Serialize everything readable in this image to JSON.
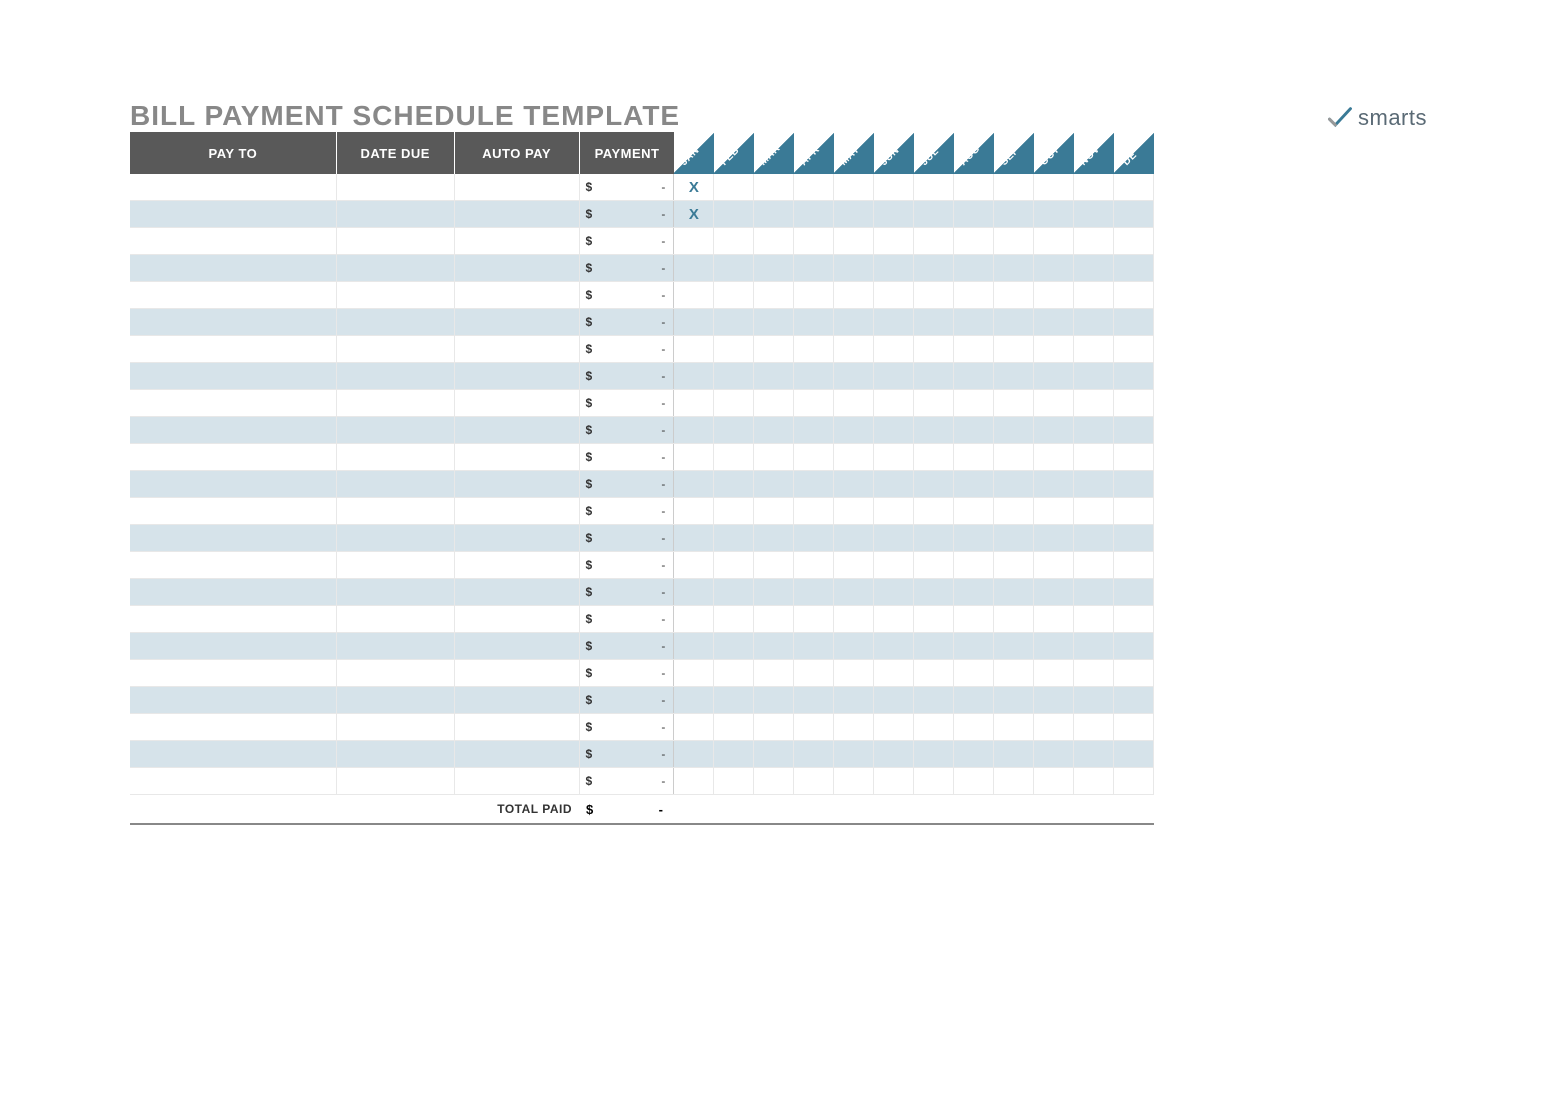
{
  "title": "BILL PAYMENT SCHEDULE TEMPLATE",
  "logo_text": "smarts",
  "headers": {
    "pay_to": "PAY TO",
    "date_due": "DATE DUE",
    "auto_pay": "AUTO PAY",
    "payment": "PAYMENT"
  },
  "months": [
    "JAN",
    "FEB",
    "MAR",
    "APR",
    "MAY",
    "JUN",
    "JUL",
    "AUG",
    "SEP",
    "OCT",
    "NOV",
    "DE"
  ],
  "currency": "$",
  "dash": "-",
  "rows": [
    {
      "pay_to": "",
      "date_due": "",
      "auto_pay": "",
      "payment": "-",
      "marks": [
        "X",
        "",
        "",
        "",
        "",
        "",
        "",
        "",
        "",
        "",
        "",
        ""
      ]
    },
    {
      "pay_to": "",
      "date_due": "",
      "auto_pay": "",
      "payment": "-",
      "marks": [
        "X",
        "",
        "",
        "",
        "",
        "",
        "",
        "",
        "",
        "",
        "",
        ""
      ]
    },
    {
      "pay_to": "",
      "date_due": "",
      "auto_pay": "",
      "payment": "-",
      "marks": [
        "",
        "",
        "",
        "",
        "",
        "",
        "",
        "",
        "",
        "",
        "",
        ""
      ]
    },
    {
      "pay_to": "",
      "date_due": "",
      "auto_pay": "",
      "payment": "-",
      "marks": [
        "",
        "",
        "",
        "",
        "",
        "",
        "",
        "",
        "",
        "",
        "",
        ""
      ]
    },
    {
      "pay_to": "",
      "date_due": "",
      "auto_pay": "",
      "payment": "-",
      "marks": [
        "",
        "",
        "",
        "",
        "",
        "",
        "",
        "",
        "",
        "",
        "",
        ""
      ]
    },
    {
      "pay_to": "",
      "date_due": "",
      "auto_pay": "",
      "payment": "-",
      "marks": [
        "",
        "",
        "",
        "",
        "",
        "",
        "",
        "",
        "",
        "",
        "",
        ""
      ]
    },
    {
      "pay_to": "",
      "date_due": "",
      "auto_pay": "",
      "payment": "-",
      "marks": [
        "",
        "",
        "",
        "",
        "",
        "",
        "",
        "",
        "",
        "",
        "",
        ""
      ]
    },
    {
      "pay_to": "",
      "date_due": "",
      "auto_pay": "",
      "payment": "-",
      "marks": [
        "",
        "",
        "",
        "",
        "",
        "",
        "",
        "",
        "",
        "",
        "",
        ""
      ]
    },
    {
      "pay_to": "",
      "date_due": "",
      "auto_pay": "",
      "payment": "-",
      "marks": [
        "",
        "",
        "",
        "",
        "",
        "",
        "",
        "",
        "",
        "",
        "",
        ""
      ]
    },
    {
      "pay_to": "",
      "date_due": "",
      "auto_pay": "",
      "payment": "-",
      "marks": [
        "",
        "",
        "",
        "",
        "",
        "",
        "",
        "",
        "",
        "",
        "",
        ""
      ]
    },
    {
      "pay_to": "",
      "date_due": "",
      "auto_pay": "",
      "payment": "-",
      "marks": [
        "",
        "",
        "",
        "",
        "",
        "",
        "",
        "",
        "",
        "",
        "",
        ""
      ]
    },
    {
      "pay_to": "",
      "date_due": "",
      "auto_pay": "",
      "payment": "-",
      "marks": [
        "",
        "",
        "",
        "",
        "",
        "",
        "",
        "",
        "",
        "",
        "",
        ""
      ]
    },
    {
      "pay_to": "",
      "date_due": "",
      "auto_pay": "",
      "payment": "-",
      "marks": [
        "",
        "",
        "",
        "",
        "",
        "",
        "",
        "",
        "",
        "",
        "",
        ""
      ]
    },
    {
      "pay_to": "",
      "date_due": "",
      "auto_pay": "",
      "payment": "-",
      "marks": [
        "",
        "",
        "",
        "",
        "",
        "",
        "",
        "",
        "",
        "",
        "",
        ""
      ]
    },
    {
      "pay_to": "",
      "date_due": "",
      "auto_pay": "",
      "payment": "-",
      "marks": [
        "",
        "",
        "",
        "",
        "",
        "",
        "",
        "",
        "",
        "",
        "",
        ""
      ]
    },
    {
      "pay_to": "",
      "date_due": "",
      "auto_pay": "",
      "payment": "-",
      "marks": [
        "",
        "",
        "",
        "",
        "",
        "",
        "",
        "",
        "",
        "",
        "",
        ""
      ]
    },
    {
      "pay_to": "",
      "date_due": "",
      "auto_pay": "",
      "payment": "-",
      "marks": [
        "",
        "",
        "",
        "",
        "",
        "",
        "",
        "",
        "",
        "",
        "",
        ""
      ]
    },
    {
      "pay_to": "",
      "date_due": "",
      "auto_pay": "",
      "payment": "-",
      "marks": [
        "",
        "",
        "",
        "",
        "",
        "",
        "",
        "",
        "",
        "",
        "",
        ""
      ]
    },
    {
      "pay_to": "",
      "date_due": "",
      "auto_pay": "",
      "payment": "-",
      "marks": [
        "",
        "",
        "",
        "",
        "",
        "",
        "",
        "",
        "",
        "",
        "",
        ""
      ]
    },
    {
      "pay_to": "",
      "date_due": "",
      "auto_pay": "",
      "payment": "-",
      "marks": [
        "",
        "",
        "",
        "",
        "",
        "",
        "",
        "",
        "",
        "",
        "",
        ""
      ]
    },
    {
      "pay_to": "",
      "date_due": "",
      "auto_pay": "",
      "payment": "-",
      "marks": [
        "",
        "",
        "",
        "",
        "",
        "",
        "",
        "",
        "",
        "",
        "",
        ""
      ]
    },
    {
      "pay_to": "",
      "date_due": "",
      "auto_pay": "",
      "payment": "-",
      "marks": [
        "",
        "",
        "",
        "",
        "",
        "",
        "",
        "",
        "",
        "",
        "",
        ""
      ]
    },
    {
      "pay_to": "",
      "date_due": "",
      "auto_pay": "",
      "payment": "-",
      "marks": [
        "",
        "",
        "",
        "",
        "",
        "",
        "",
        "",
        "",
        "",
        "",
        ""
      ]
    }
  ],
  "total": {
    "label": "TOTAL PAID",
    "currency": "$",
    "value": "-"
  }
}
